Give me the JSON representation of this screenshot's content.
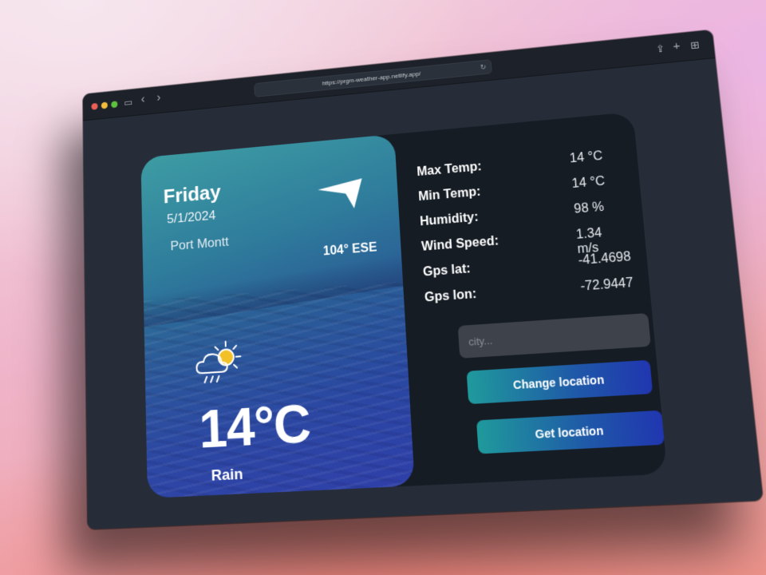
{
  "browser": {
    "url": "https://prgm-weather-app.netlify.app/",
    "reload_glyph": "↻",
    "sidebar_glyph": "▭",
    "back_glyph": "‹",
    "forward_glyph": "›",
    "share_glyph": "⇪",
    "new_tab_glyph": "+",
    "tabs_glyph": "⊞"
  },
  "weather": {
    "day": "Friday",
    "date": "5/1/2024",
    "city": "Port Montt",
    "wind_direction": "104° ESE",
    "temperature": "14°C",
    "condition": "Rain"
  },
  "stats": [
    {
      "label": "Max Temp:",
      "value": "14 °C"
    },
    {
      "label": "Min Temp:",
      "value": "14 °C"
    },
    {
      "label": "Humidity:",
      "value": "98 %"
    },
    {
      "label": "Wind Speed:",
      "value": "1.34 m/s"
    },
    {
      "label": "Gps lat:",
      "value": "-41.4698"
    },
    {
      "label": "Gps lon:",
      "value": "-72.9447"
    }
  ],
  "form": {
    "city_placeholder": "city...",
    "change_label": "Change location",
    "get_label": "Get location"
  },
  "icons": {
    "wind": "wind-arrow-icon",
    "weather": "sun-cloud-rain-icon"
  },
  "colors": {
    "accent_start": "#1f9a9c",
    "accent_end": "#2036b0",
    "panel": "#161c24"
  }
}
